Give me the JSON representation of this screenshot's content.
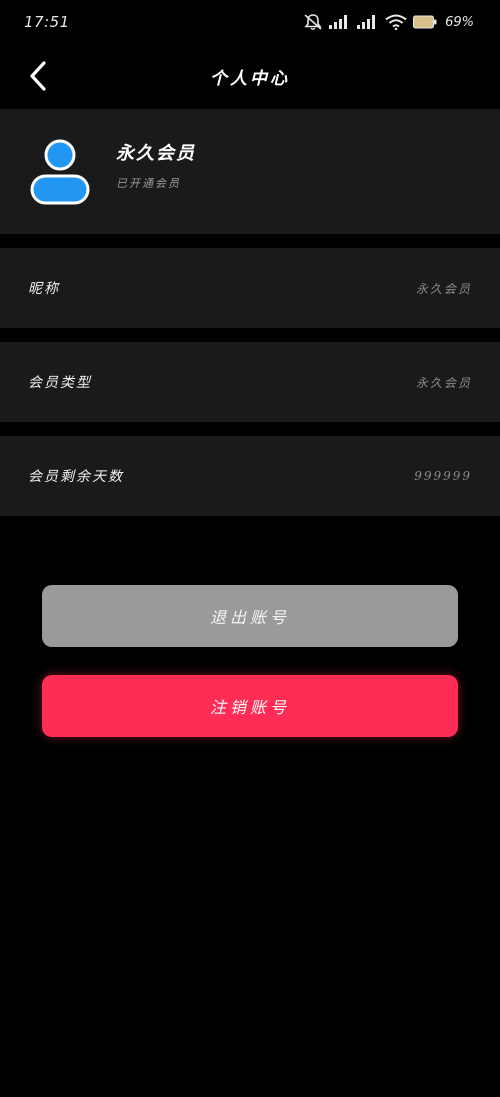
{
  "status_bar": {
    "time": "17:51",
    "battery": "69%",
    "icons": [
      "mute-icon",
      "signal-icon",
      "signal-icon",
      "wifi-icon",
      "battery-icon"
    ]
  },
  "header": {
    "title": "个人中心",
    "back_icon": "chevron-left-icon"
  },
  "profile": {
    "name": "永久会员",
    "subtitle": "已开通会员",
    "avatar_icon": "user-avatar-icon",
    "avatar_color": "#2196f3"
  },
  "rows": {
    "nickname": {
      "label": "昵称",
      "value": "永久会员"
    },
    "member_type": {
      "label": "会员类型",
      "value": "永久会员"
    },
    "days_left": {
      "label": "会员剩余天数",
      "value": "999999"
    }
  },
  "buttons": {
    "logout": "退出账号",
    "delete_account": "注销账号"
  },
  "colors": {
    "background": "#000000",
    "card": "#1a1a1a",
    "logout_button": "#9a9a9a",
    "delete_button": "#ff2d55"
  }
}
